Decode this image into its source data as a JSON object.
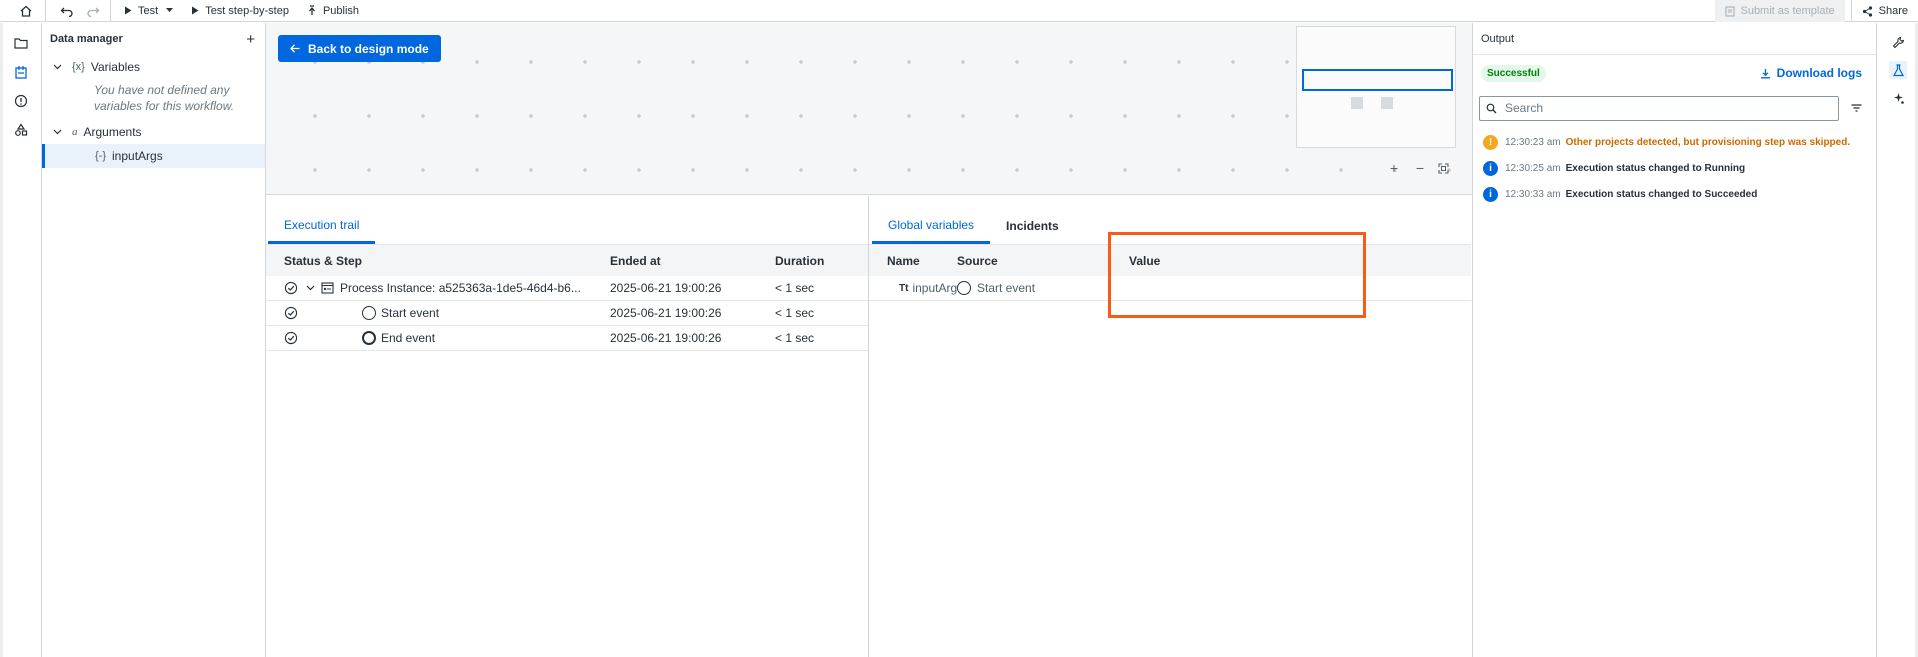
{
  "toolbar": {
    "test_label": "Test",
    "test_step_label": "Test step-by-step",
    "publish_label": "Publish",
    "submit_template_label": "Submit as template",
    "share_label": "Share"
  },
  "data_manager": {
    "title": "Data manager",
    "add_symbol": "+",
    "variables_type_icon": "{x}",
    "variables_label": "Variables",
    "variables_empty": "You have not defined any variables for this workflow.",
    "arguments_type_icon": "a",
    "arguments_label": "Arguments",
    "arg_item_icon": "{-}",
    "arg_item_label": "inputArgs"
  },
  "canvas": {
    "back_button_label": "Back to design mode",
    "zoom_in": "+",
    "zoom_out": "−"
  },
  "execution_trail": {
    "tab_label": "Execution trail",
    "columns": {
      "status_step": "Status & Step",
      "ended_at": "Ended at",
      "duration": "Duration"
    },
    "rows": [
      {
        "step": "Process Instance: a525363a-1de5-46d4-b6...",
        "ended": "2025-06-21 19:00:26",
        "duration": "< 1 sec"
      },
      {
        "step": "Start event",
        "ended": "2025-06-21 19:00:26",
        "duration": "< 1 sec"
      },
      {
        "step": "End event",
        "ended": "2025-06-21 19:00:26",
        "duration": "< 1 sec"
      }
    ]
  },
  "global_variables": {
    "tab_label": "Global variables",
    "incidents_tab_label": "Incidents",
    "columns": {
      "name": "Name",
      "source": "Source",
      "value": "Value"
    },
    "rows": [
      {
        "type_icon": "Tt",
        "name": "inputArgs",
        "source": "Start event",
        "value": ""
      }
    ]
  },
  "output": {
    "title": "Output",
    "status_badge": "Successful",
    "download_label": "Download logs",
    "search_placeholder": "Search",
    "logs": [
      {
        "level": "warning",
        "time": "12:30:23 am",
        "message": "Other projects detected, but provisioning step was skipped."
      },
      {
        "level": "info",
        "time": "12:30:25 am",
        "message": "Execution status changed to Running"
      },
      {
        "level": "info",
        "time": "12:30:33 am",
        "message": "Execution status changed to Succeeded"
      }
    ]
  },
  "colors": {
    "accent": "#0067df",
    "highlight": "#fa5a14",
    "success_text": "#038108",
    "warning": "#f5a623",
    "info": "#0067df"
  },
  "icons": {
    "home": "home-icon",
    "undo": "undo-icon",
    "redo": "redo-icon",
    "play": "play-icon",
    "publish": "publish-icon",
    "share": "share-icon",
    "files": "files-icon",
    "data_manager": "data-manager-icon",
    "errors": "errors-icon",
    "resources": "resources-icon",
    "check": "check-circle-icon",
    "download": "download-icon",
    "search": "search-icon",
    "filter": "filter-icon",
    "properties": "properties-icon",
    "test_output": "test-output-icon",
    "autopilot": "autopilot-icon"
  }
}
